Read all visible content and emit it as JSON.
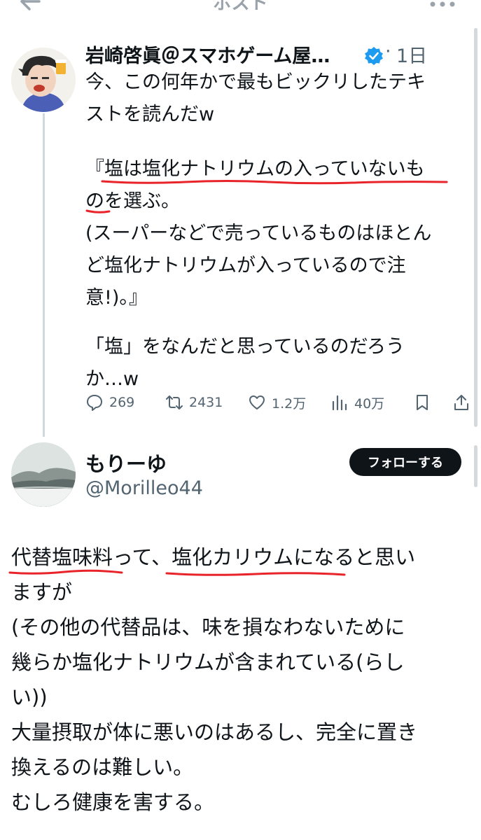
{
  "header": {
    "title": "ポスト"
  },
  "quoted_post": {
    "author_name": "岩崎啓眞＠スマホゲーム屋…",
    "separator": "·",
    "time": "1日",
    "lines": [
      "今、この何年かで最もビックリしたテキ",
      "ストを読んだw",
      "『塩は塩化ナトリウムの入っていないも",
      "のを選ぶ。",
      "(スーパーなどで売っているものはほとん",
      "ど塩化ナトリウムが入っているので注",
      "意!)。』",
      "「塩」をなんだと思っているのだろう",
      "か…w"
    ],
    "stats": {
      "replies": "269",
      "reposts": "2431",
      "likes": "1.2万",
      "views": "40万"
    }
  },
  "reply_post": {
    "author_name": "もりーゆ",
    "handle": "@Morilleo44",
    "follow_label": "フォローする",
    "lines": [
      "代替塩味料って、塩化カリウムになると思い",
      "ますが",
      "(その他の代替品は、味を損なわないために",
      "幾らか塩化ナトリウムが含まれている(らし",
      "い))",
      "大量摂取が体に悪いのはあるし、完全に置き",
      "換えるのは難しい。",
      "むしろ健康を害する。"
    ]
  },
  "colors": {
    "text": "#0f1419",
    "secondary": "#536471",
    "verified": "#1d9bf0",
    "underline": "#e8242a",
    "thread": "#cfd9de"
  }
}
